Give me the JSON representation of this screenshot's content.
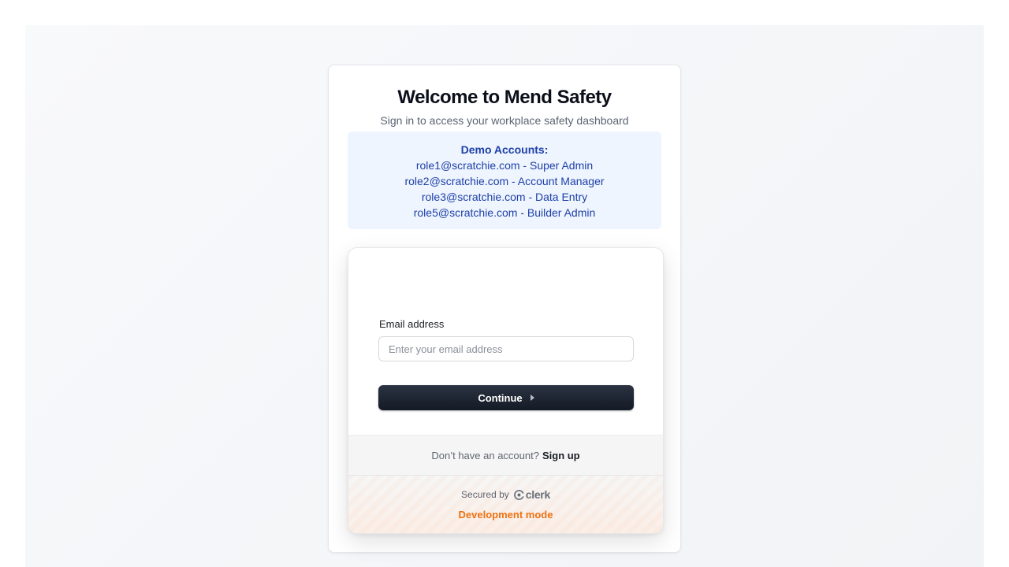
{
  "page": {
    "title": "Welcome to Mend Safety",
    "subtitle": "Sign in to access your workplace safety dashboard"
  },
  "demo_accounts": {
    "heading": "Demo Accounts:",
    "items": [
      "role1@scratchie.com - Super Admin",
      "role2@scratchie.com - Account Manager",
      "role3@scratchie.com - Data Entry",
      "role5@scratchie.com - Builder Admin"
    ]
  },
  "sign_in": {
    "email_label": "Email address",
    "email_value": "",
    "email_placeholder": "Enter your email address",
    "continue_label": "Continue",
    "no_account_text": "Don’t have an account?",
    "sign_up_label": "Sign up"
  },
  "footer": {
    "secured_by": "Secured by",
    "brand": "clerk",
    "dev_mode": "Development mode"
  },
  "colors": {
    "primary_button": "#141a25",
    "demo_box_bg": "#eef5fe",
    "demo_text": "#1f40a8",
    "dev_mode": "#ec7212"
  },
  "icons": {
    "continue": "play-triangle-icon",
    "brand": "clerk-logo-icon"
  }
}
